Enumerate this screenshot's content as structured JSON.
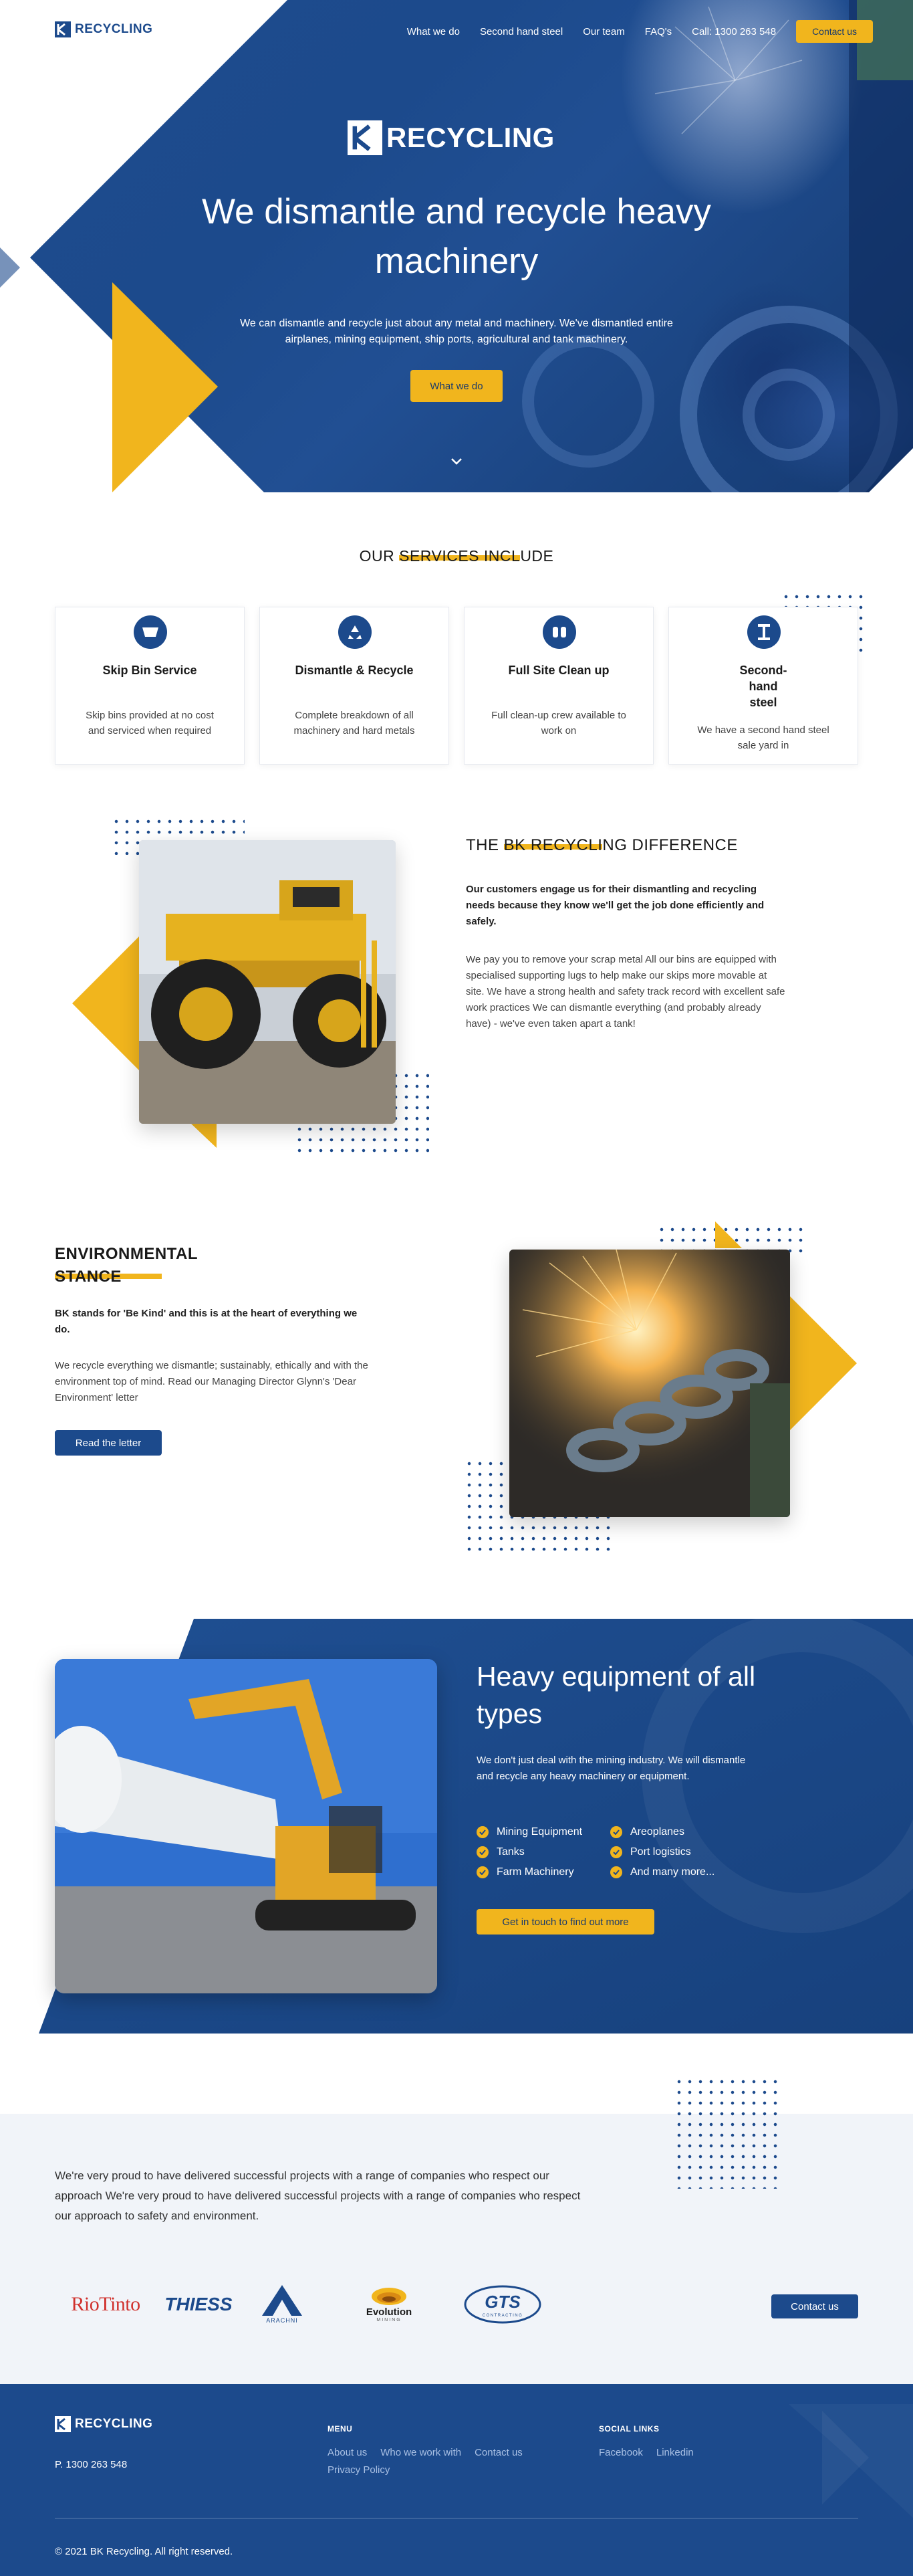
{
  "brand": {
    "name": "RECYCLING",
    "mark": "BK"
  },
  "nav": {
    "links": [
      "What we do",
      "Second hand steel",
      "Our team",
      "FAQ's"
    ],
    "phone": "Call: 1300 263 548",
    "contact_label": "Contact us"
  },
  "hero": {
    "title": "We dismantle and recycle heavy machinery",
    "subtitle": "We can dismantle and recycle just about any metal and machinery. We've dismantled entire airplanes, mining equipment, ship ports, agricultural and tank machinery.",
    "button_label": "What we do",
    "scroll_icon": "chevron-down-icon"
  },
  "services": {
    "title_pre": "OUR ",
    "title_hl": "SERVICES INCL",
    "title_post": "UDE",
    "cards": [
      {
        "icon": "skip-bin-icon",
        "title": "Skip Bin Service",
        "text": "Skip bins provided at no cost and serviced when required"
      },
      {
        "icon": "recycle-icon",
        "title": "Dismantle & Recycle",
        "text": "Complete breakdown of all machinery and hard metals"
      },
      {
        "icon": "gloves-icon",
        "title": "Full Site Clean up",
        "text": "Full clean-up crew available to work on"
      },
      {
        "icon": "steel-beam-icon",
        "title": "Second-hand steel",
        "text": "We have a second hand steel sale yard in"
      }
    ]
  },
  "difference": {
    "title_pre": "THE ",
    "title_hl": "BK RECYCLI",
    "title_post": "NG DIFFERENCE",
    "lead": "Our customers engage us for their dismantling and recycling needs because they know we'll get the job done efficiently and safely.",
    "body": "We pay you to remove your scrap metal All our bins are equipped with specialised supporting lugs to help make our skips more movable at site. We have a strong health and safety track record with excellent safe work practices We can dismantle everything (and probably already have) - we've even taken apart a tank!"
  },
  "environment": {
    "title_line1": "ENVIRONMENTAL",
    "title_line2": "STANCE",
    "lead": "BK stands for 'Be Kind' and this is at the heart of everything we do.",
    "body": "We recycle everything we dismantle; sustainably, ethically and with the environment top of mind. Read our Managing Director Glynn's 'Dear Environment' letter",
    "button_label": "Read the letter"
  },
  "equipment": {
    "title": "Heavy equipment of all types",
    "text": "We don't just deal with the mining industry. We will dismantle and recycle any heavy machinery or equipment.",
    "items": [
      "Mining Equipment",
      "Areoplanes",
      "Tanks",
      "Port logistics",
      "Farm Machinery",
      "And many more..."
    ],
    "button_label": "Get in touch to find out more"
  },
  "clients": {
    "text": "We're very proud to have delivered successful projects with a range of companies who respect our approach We're very proud to have delivered successful projects with a range of companies who respect our approach to safety and environment.",
    "logos": [
      "RioTinto",
      "THIESS",
      "ARACHNI",
      "Evolution",
      "GTS"
    ],
    "evolution_tagline": "MINING",
    "gts_tagline": "CONTRACTING",
    "button_label": "Contact us"
  },
  "footer": {
    "phone": "P. 1300 263 548",
    "menu_heading": "MENU",
    "menu_links": [
      "About us",
      "Who we work with",
      "Contact us",
      "Privacy Policy"
    ],
    "social_heading": "SOCIAL LINKS",
    "social_links": [
      "Facebook",
      "Linkedin"
    ],
    "copyright": "© 2021 BK Recycling. All right reserved."
  },
  "colors": {
    "navy": "#1c4a8c",
    "yellow": "#f1b51d",
    "light_bg": "#f1f4f9"
  }
}
